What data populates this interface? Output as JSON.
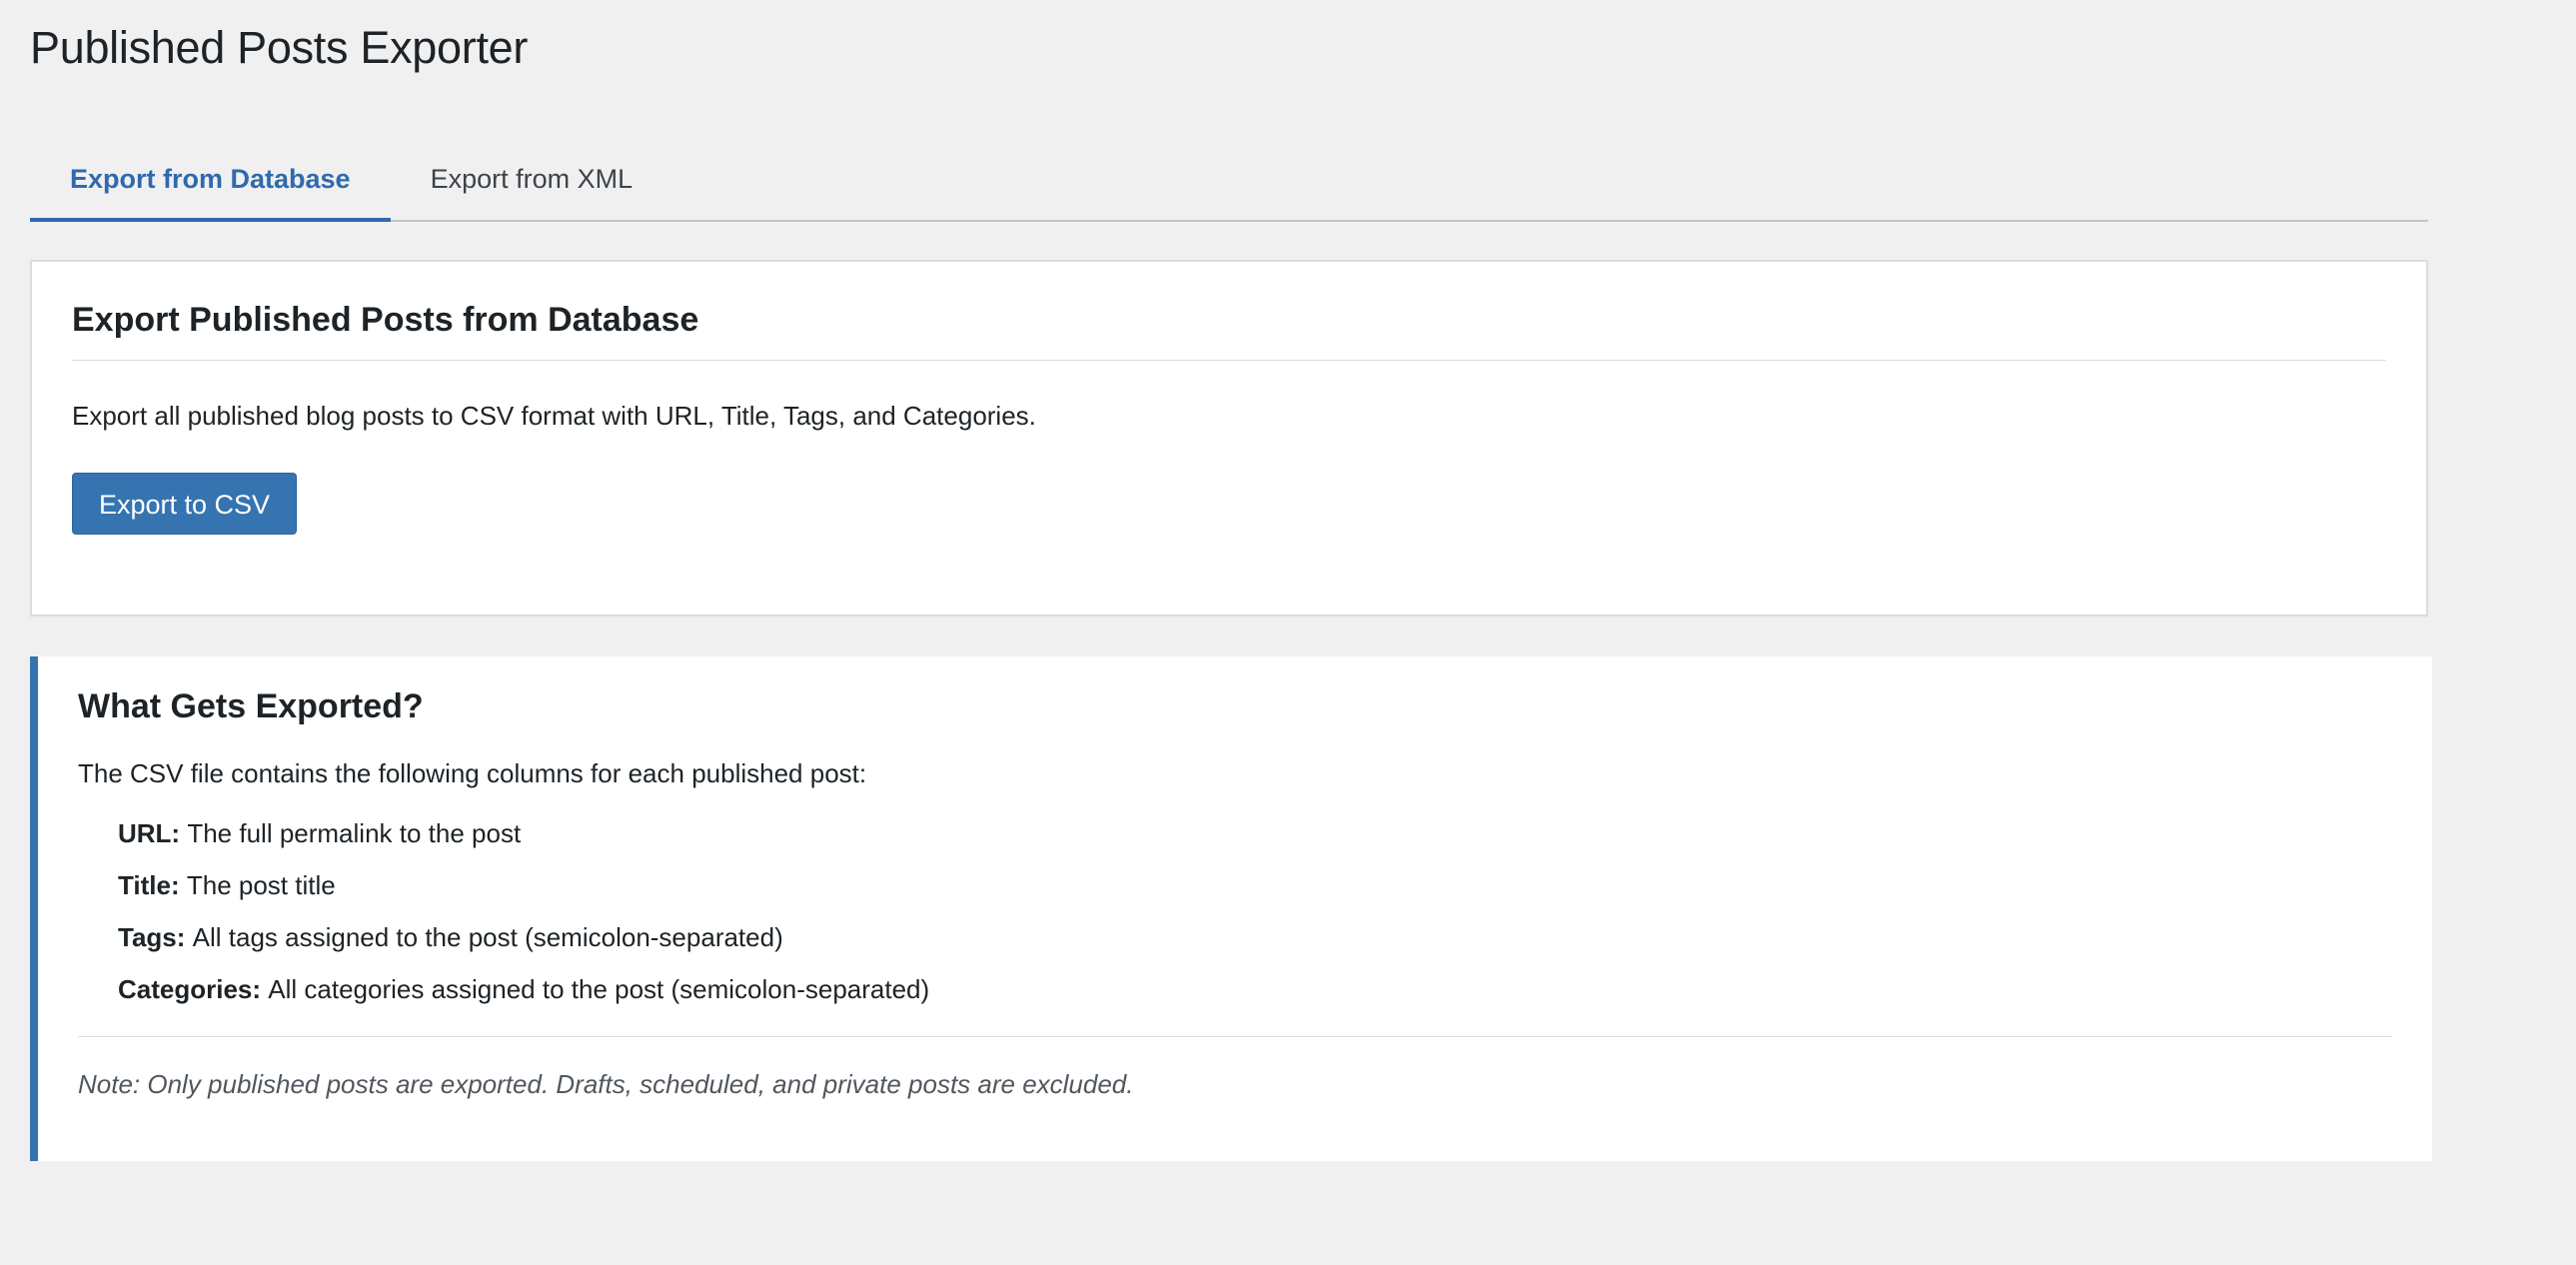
{
  "page": {
    "title": "Published Posts Exporter"
  },
  "tabs": [
    {
      "label": "Export from Database",
      "active": true
    },
    {
      "label": "Export from XML",
      "active": false
    }
  ],
  "export_card": {
    "heading": "Export Published Posts from Database",
    "description": "Export all published blog posts to CSV format with URL, Title, Tags, and Categories.",
    "button_label": "Export to CSV"
  },
  "info_box": {
    "heading": "What Gets Exported?",
    "lead": "The CSV file contains the following columns for each published post:",
    "columns": [
      {
        "name": "URL:",
        "desc": "The full permalink to the post"
      },
      {
        "name": "Title:",
        "desc": "The post title"
      },
      {
        "name": "Tags:",
        "desc": "All tags assigned to the post (semicolon-separated)"
      },
      {
        "name": "Categories:",
        "desc": "All categories assigned to the post (semicolon-separated)"
      }
    ],
    "note": "Note: Only published posts are exported. Drafts, scheduled, and private posts are excluded."
  },
  "colors": {
    "accent": "#3574b0",
    "background": "#f0f0f1",
    "text": "#1d2327"
  }
}
